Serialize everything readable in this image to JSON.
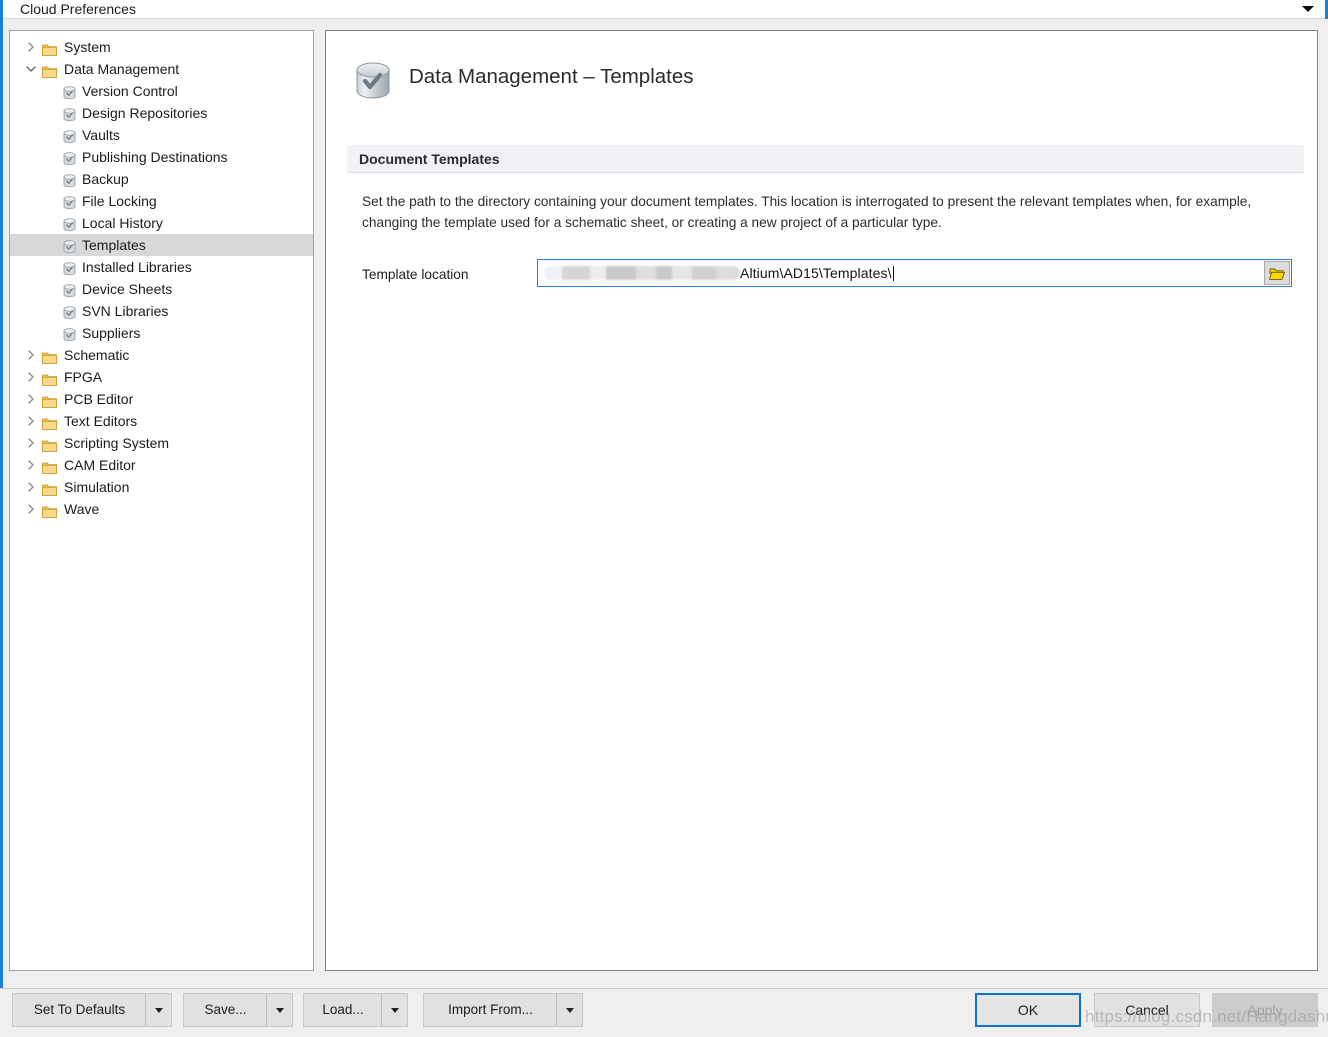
{
  "window": {
    "title": "Cloud Preferences",
    "dropdown_caret_icon": "chevron-down-icon"
  },
  "tree": {
    "items": [
      {
        "label": "System",
        "depth": 0,
        "icon": "folder-icon",
        "expander": "chevron-right-icon",
        "selected": false
      },
      {
        "label": "Data Management",
        "depth": 0,
        "icon": "folder-icon",
        "expander": "chevron-down-icon",
        "selected": false
      },
      {
        "label": "Version Control",
        "depth": 1,
        "icon": "database-check-icon",
        "expander": "",
        "selected": false
      },
      {
        "label": "Design Repositories",
        "depth": 1,
        "icon": "database-check-icon",
        "expander": "",
        "selected": false
      },
      {
        "label": "Vaults",
        "depth": 1,
        "icon": "database-check-icon",
        "expander": "",
        "selected": false
      },
      {
        "label": "Publishing Destinations",
        "depth": 1,
        "icon": "database-check-icon",
        "expander": "",
        "selected": false
      },
      {
        "label": "Backup",
        "depth": 1,
        "icon": "database-check-icon",
        "expander": "",
        "selected": false
      },
      {
        "label": "File Locking",
        "depth": 1,
        "icon": "database-check-icon",
        "expander": "",
        "selected": false
      },
      {
        "label": "Local History",
        "depth": 1,
        "icon": "database-check-icon",
        "expander": "",
        "selected": false
      },
      {
        "label": "Templates",
        "depth": 1,
        "icon": "database-check-icon",
        "expander": "",
        "selected": true
      },
      {
        "label": "Installed Libraries",
        "depth": 1,
        "icon": "database-check-icon",
        "expander": "",
        "selected": false
      },
      {
        "label": "Device Sheets",
        "depth": 1,
        "icon": "database-check-icon",
        "expander": "",
        "selected": false
      },
      {
        "label": "SVN Libraries",
        "depth": 1,
        "icon": "database-check-icon",
        "expander": "",
        "selected": false
      },
      {
        "label": "Suppliers",
        "depth": 1,
        "icon": "database-check-icon",
        "expander": "",
        "selected": false
      },
      {
        "label": "Schematic",
        "depth": 0,
        "icon": "folder-icon",
        "expander": "chevron-right-icon",
        "selected": false
      },
      {
        "label": "FPGA",
        "depth": 0,
        "icon": "folder-icon",
        "expander": "chevron-right-icon",
        "selected": false
      },
      {
        "label": "PCB Editor",
        "depth": 0,
        "icon": "folder-icon",
        "expander": "chevron-right-icon",
        "selected": false
      },
      {
        "label": "Text Editors",
        "depth": 0,
        "icon": "folder-icon",
        "expander": "chevron-right-icon",
        "selected": false
      },
      {
        "label": "Scripting System",
        "depth": 0,
        "icon": "folder-icon",
        "expander": "chevron-right-icon",
        "selected": false
      },
      {
        "label": "CAM Editor",
        "depth": 0,
        "icon": "folder-icon",
        "expander": "chevron-right-icon",
        "selected": false
      },
      {
        "label": "Simulation",
        "depth": 0,
        "icon": "folder-icon",
        "expander": "chevron-right-icon",
        "selected": false
      },
      {
        "label": "Wave",
        "depth": 0,
        "icon": "folder-icon",
        "expander": "chevron-right-icon",
        "selected": false
      }
    ]
  },
  "page": {
    "icon": "database-check-icon",
    "title": "Data Management – Templates",
    "section": {
      "title": "Document Templates",
      "description": "Set the path to the directory containing your document templates. This location is interrogated to present the relevant templates when, for example, changing the template used for a schematic sheet, or creating a new project of a particular type."
    },
    "field": {
      "label": "Template location",
      "value_visible": "Altium\\AD15\\Templates\\",
      "value_redacted": true,
      "browse_icon": "open-folder-icon"
    }
  },
  "footer": {
    "left_buttons": [
      {
        "label": "Set To Defaults",
        "has_dropdown": true,
        "name": "set-to-defaults"
      },
      {
        "label": "Save...",
        "has_dropdown": true,
        "name": "save"
      },
      {
        "label": "Load...",
        "has_dropdown": true,
        "name": "load"
      },
      {
        "label": "Import From...",
        "has_dropdown": true,
        "name": "import-from"
      }
    ],
    "ok_label": "OK",
    "cancel_label": "Cancel",
    "apply_label": "Apply",
    "apply_disabled": true
  },
  "watermark": "https://blog.csdn.net/Hangdashuai",
  "colors": {
    "accent": "#1a7fd4",
    "selection": "#d8d8d8",
    "panel_border": "#7a838d",
    "band": "#f0f2f5",
    "folder": "#f3c54e",
    "chrome": "#efefef"
  }
}
